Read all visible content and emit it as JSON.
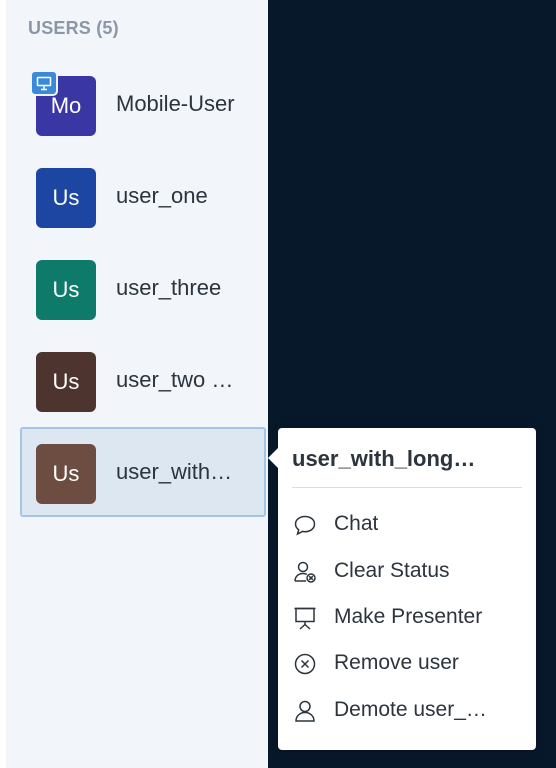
{
  "users_panel": {
    "header": "USERS (5)",
    "users": [
      {
        "initials": "Mo",
        "name": "Mobile-User",
        "avatar_color": "#3a36a3",
        "presenter": true
      },
      {
        "initials": "Us",
        "name": "user_one",
        "avatar_color": "#1d46a3"
      },
      {
        "initials": "Us",
        "name": "user_three",
        "avatar_color": "#0d7a6a"
      },
      {
        "initials": "Us",
        "name": "user_two …",
        "avatar_color": "#4e342e"
      },
      {
        "initials": "Us",
        "name": "user_with…",
        "avatar_color": "#6d4c41",
        "selected": true
      }
    ]
  },
  "user_menu": {
    "title": "user_with_long…",
    "items": [
      {
        "label": "Chat",
        "icon": "chat-icon"
      },
      {
        "label": "Clear Status",
        "icon": "clear-status-icon"
      },
      {
        "label": "Make Presenter",
        "icon": "presenter-icon"
      },
      {
        "label": "Remove user",
        "icon": "remove-user-icon"
      },
      {
        "label": "Demote user_…",
        "icon": "demote-user-icon"
      }
    ]
  },
  "colors": {
    "sidebar_bg": "#f2f5f9",
    "dark_bg": "#08182b",
    "selected_bg": "#dce7f2",
    "selected_border": "#a6c4e6",
    "presenter_badge": "#3b8ad9"
  }
}
